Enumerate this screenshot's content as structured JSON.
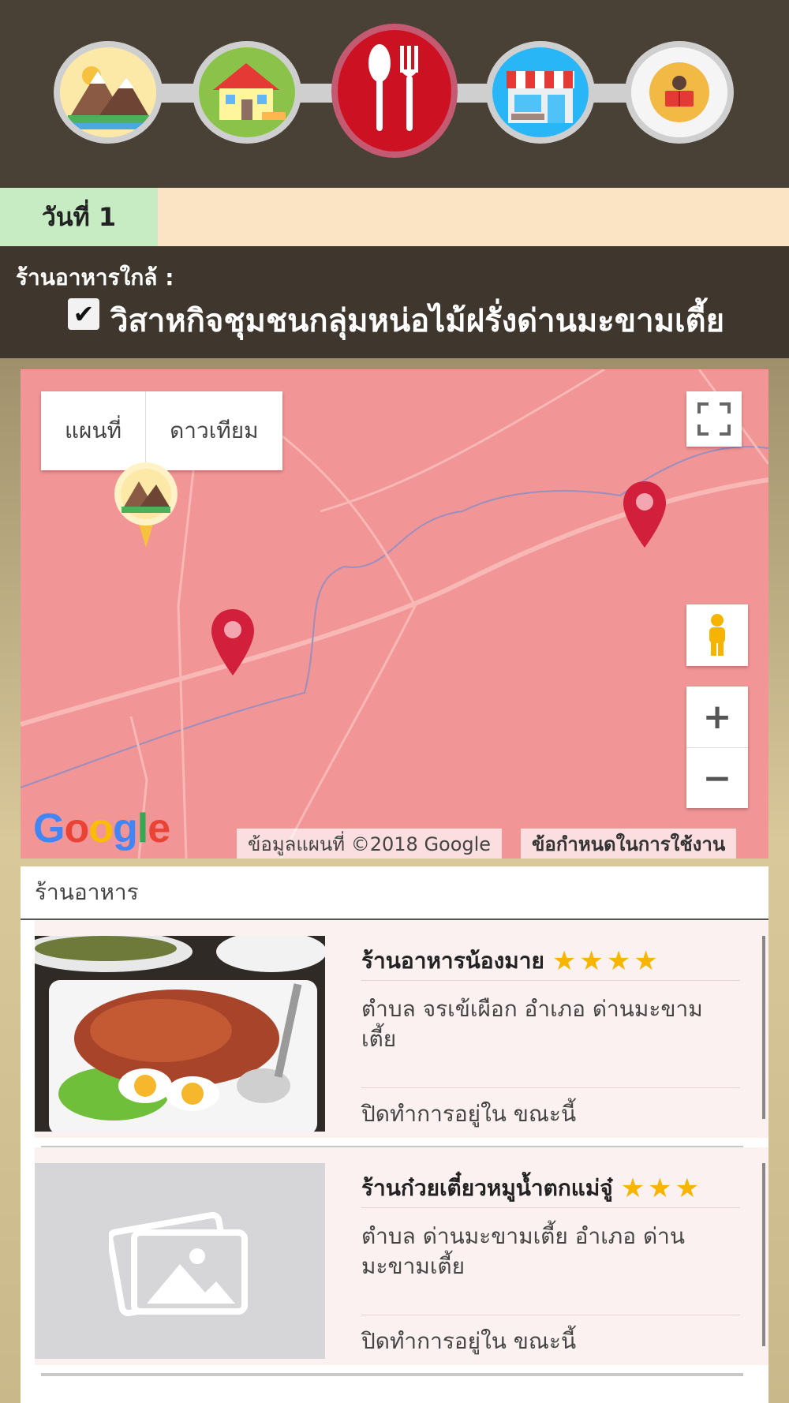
{
  "categories": [
    {
      "name": "attractions",
      "icon": "mountain-icon",
      "active": false
    },
    {
      "name": "accommodation",
      "icon": "house-icon",
      "active": false
    },
    {
      "name": "restaurants",
      "icon": "spoon-fork-icon",
      "active": true
    },
    {
      "name": "shops",
      "icon": "storefront-icon",
      "active": false
    },
    {
      "name": "guide",
      "icon": "reading-person-icon",
      "active": false
    }
  ],
  "day_tab": {
    "label": "วันที่ 1"
  },
  "nearby": {
    "title": "ร้านอาหารใกล้ :",
    "checkbox_mark": "✔",
    "checkbox_label": "วิสาหกิจชุมชนกลุ่มหน่อไม้ฝรั่งด่านมะขามเตี้ย"
  },
  "map": {
    "type_map": "แผนที่",
    "type_satellite": "ดาวเทียม",
    "zoom_in": "+",
    "zoom_out": "−",
    "logo": "Google",
    "attribution": "ข้อมูลแผนที่ ©2018 Google",
    "terms": "ข้อกำหนดในการใช้งาน",
    "colors": {
      "land": "#f29596",
      "road": "#f8b8b6",
      "pin": "#d11f3c"
    }
  },
  "list": {
    "header": "ร้านอาหาร",
    "items": [
      {
        "name": "ร้านอาหารน้องมาย",
        "stars": "★★★★",
        "rating": 4,
        "address": "ตำบล จรเข้เผือก อำเภอ ด่านมะขามเตี้ย",
        "status": "ปิดทำการอยู่ใน ขณะนี้"
      },
      {
        "name": "ร้านก๋วยเตี๋ยวหมูน้ำตกแม่จู๋",
        "stars": "★★★",
        "rating": 3,
        "address": "ตำบล ด่านมะขามเตี้ย อำเภอ ด่านมะขามเตี้ย",
        "status": "ปิดทำการอยู่ใน ขณะนี้"
      }
    ]
  }
}
